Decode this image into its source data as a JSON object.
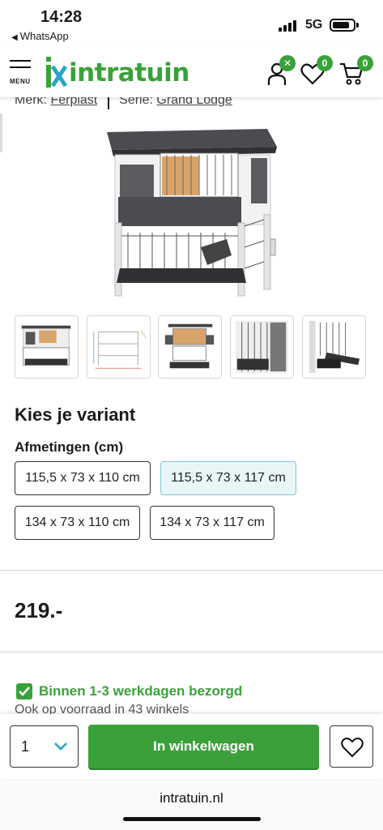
{
  "status": {
    "time": "14:28",
    "back_app": "WhatsApp",
    "network": "5G"
  },
  "header": {
    "menu_label": "MENU",
    "logo_text": "intratuin",
    "account_badge": "✕",
    "wishlist_count": "0",
    "cart_count": "0",
    "brand_color": "#3aa13a"
  },
  "product": {
    "brand_label": "Merk:",
    "brand_value": "Ferplast",
    "series_label": "Serie:",
    "series_value": "Grand Lodge",
    "thumbnails": [
      "front-view",
      "dimensions-drawing",
      "opened-view",
      "interior-close-up",
      "ramp-close-up"
    ]
  },
  "variant": {
    "title": "Kies je variant",
    "dimension_label": "Afmetingen (cm)",
    "options": [
      {
        "label": "115,5 x 73 x 110 cm",
        "selected": false
      },
      {
        "label": "115,5 x 73 x 117 cm",
        "selected": true
      },
      {
        "label": "134 x 73 x 110 cm",
        "selected": false
      },
      {
        "label": "134 x 73 x 117 cm",
        "selected": false
      }
    ]
  },
  "price": "219.-",
  "delivery": {
    "text": "Binnen 1-3 werkdagen bezorgd",
    "stock": "Ook op voorraad in 43 winkels"
  },
  "actions": {
    "quantity": "1",
    "add_to_cart": "In winkelwagen"
  },
  "browser": {
    "url": "intratuin.nl"
  }
}
